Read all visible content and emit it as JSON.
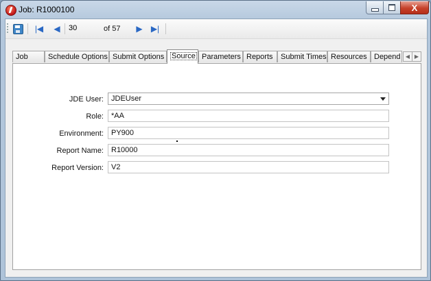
{
  "window": {
    "title": "Job: R1000100",
    "controls": {
      "minimize": "",
      "maximize": "",
      "close": "X"
    }
  },
  "toolbar": {
    "current_record": "30",
    "of_label": "of 57"
  },
  "tabs": [
    {
      "label": "Job",
      "active": false
    },
    {
      "label": "Schedule Options",
      "active": false
    },
    {
      "label": "Submit Options",
      "active": false
    },
    {
      "label": "Source",
      "active": true
    },
    {
      "label": "Parameters",
      "active": false
    },
    {
      "label": "Reports",
      "active": false
    },
    {
      "label": "Submit Times",
      "active": false
    },
    {
      "label": "Resources",
      "active": false
    },
    {
      "label": "Depend",
      "active": false
    }
  ],
  "form": {
    "jde_user": {
      "label": "JDE User:",
      "value": "JDEUser"
    },
    "role": {
      "label": "Role:",
      "value": "*AA"
    },
    "environment": {
      "label": "Environment:",
      "value": "PY900"
    },
    "report_name": {
      "label": "Report Name:",
      "value": "R10000"
    },
    "report_version": {
      "label": "Report Version:",
      "value": "V2"
    }
  },
  "colors": {
    "accent": "#2a68c4",
    "close_button": "#c6412a"
  }
}
